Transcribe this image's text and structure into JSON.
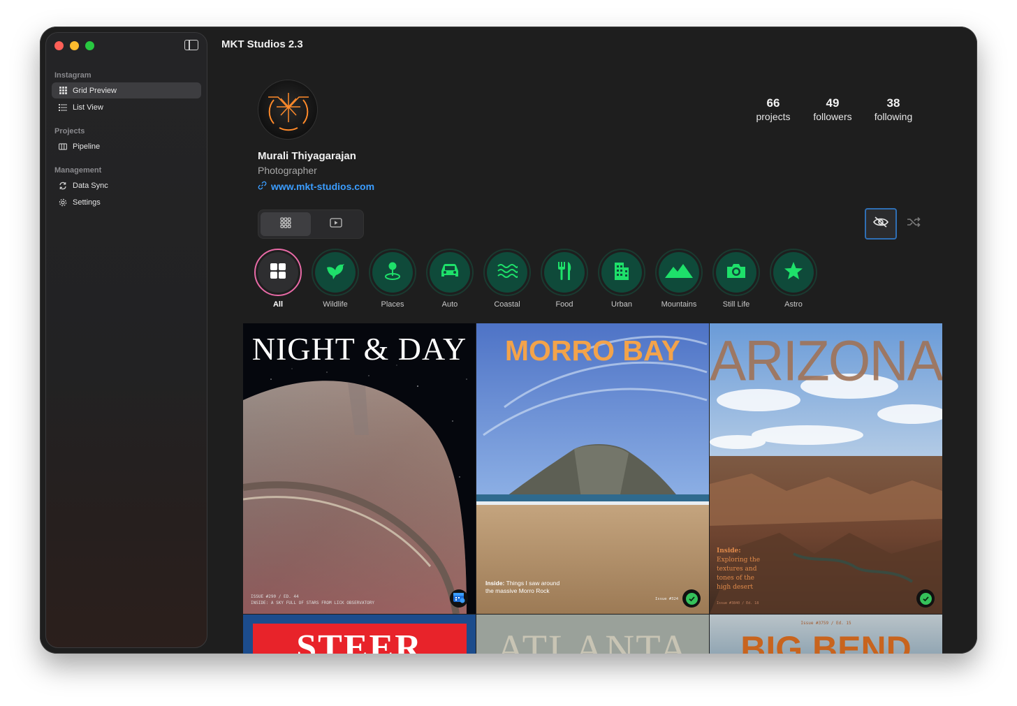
{
  "app": {
    "title": "MKT Studios 2.3"
  },
  "sidebar": {
    "sections": [
      {
        "label": "Instagram",
        "items": [
          {
            "label": "Grid Preview",
            "icon": "grid-icon",
            "selected": true
          },
          {
            "label": "List View",
            "icon": "list-icon"
          }
        ]
      },
      {
        "label": "Projects",
        "items": [
          {
            "label": "Pipeline",
            "icon": "columns-icon"
          }
        ]
      },
      {
        "label": "Management",
        "items": [
          {
            "label": "Data Sync",
            "icon": "sync-icon"
          },
          {
            "label": "Settings",
            "icon": "gear-icon"
          }
        ]
      }
    ]
  },
  "profile": {
    "name": "Murali Thiyagarajan",
    "role": "Photographer",
    "website": "www.mkt-studios.com",
    "stats": [
      {
        "value": "66",
        "label": "projects"
      },
      {
        "value": "49",
        "label": "followers"
      },
      {
        "value": "38",
        "label": "following"
      }
    ]
  },
  "categories": [
    {
      "label": "All",
      "icon": "grid-icon",
      "selected": true
    },
    {
      "label": "Wildlife",
      "icon": "bird-icon"
    },
    {
      "label": "Places",
      "icon": "map-pin-icon"
    },
    {
      "label": "Auto",
      "icon": "car-icon"
    },
    {
      "label": "Coastal",
      "icon": "waves-icon"
    },
    {
      "label": "Food",
      "icon": "fork-knife-icon"
    },
    {
      "label": "Urban",
      "icon": "building-icon"
    },
    {
      "label": "Mountains",
      "icon": "mountains-icon"
    },
    {
      "label": "Still Life",
      "icon": "camera-icon"
    },
    {
      "label": "Astro",
      "icon": "star-icon"
    }
  ],
  "tiles": {
    "night": {
      "title": "NIGHT & DAY",
      "footer1": "ISSUE #290 / ED. 44",
      "footer2": "INSIDE: A SKY FULL OF STARS FROM LICK OBSERVATORY"
    },
    "morro": {
      "title": "MORRO BAY",
      "inside_label": "Inside:",
      "inside": "Things I saw around the massive Morro Rock",
      "issue": "Issue #324"
    },
    "arizona": {
      "title": "ARIZONA",
      "inside_label": "Inside:",
      "inside": "Exploring the textures and tones of the high desert",
      "issue": "Issue #3840 / Ed. 18"
    },
    "steer": {
      "title": "STEER"
    },
    "atlanta": {
      "title": "ATLANTA"
    },
    "bigbend": {
      "title": "BIG BEND",
      "issue": "Issue #3759 / Ed. 15"
    }
  },
  "colors": {
    "accent": "#3b9dff",
    "category_green": "#1ee06a",
    "category_bg": "#0f4a3a",
    "check": "#35c25a"
  }
}
